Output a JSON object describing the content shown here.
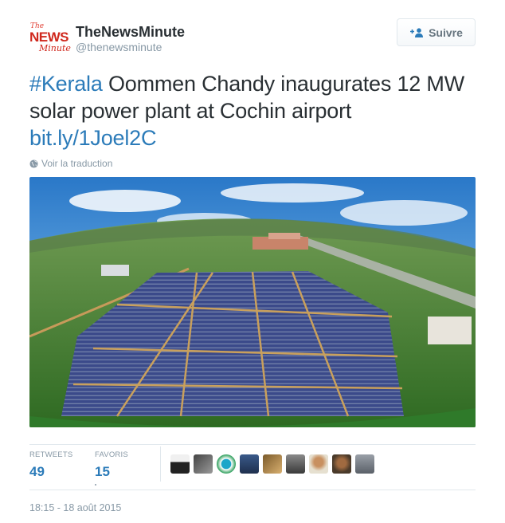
{
  "account": {
    "logo_the": "The",
    "logo_news": "NEWS",
    "logo_minute": "Minute",
    "full_name": "TheNewsMinute",
    "handle": "@thenewsminute"
  },
  "follow_button": {
    "label": "Suivre",
    "icon": "add-user-icon"
  },
  "tweet": {
    "hashtag": "#Kerala",
    "text": " Oommen Chandy inaugurates 12 MW solar power plant at Cochin airport ",
    "link": "bit.ly/1Joel2C"
  },
  "translate": {
    "label": "Voir la traduction",
    "icon": "globe-icon"
  },
  "photo": {
    "description_icon": "aerial-solar-plant-photo"
  },
  "stats": {
    "retweets_label": "RETWEETS",
    "retweets_value": "49",
    "favorites_label": "FAVORIS",
    "favorites_value": "15"
  },
  "avatars": [
    "avatar-1",
    "avatar-2",
    "avatar-3",
    "avatar-4",
    "avatar-5",
    "avatar-6",
    "avatar-7",
    "avatar-8",
    "avatar-9"
  ],
  "timestamp": "18:15 - 18 août 2015",
  "colors": {
    "link": "#2b7bb9",
    "muted": "#8899a6",
    "text": "#292f33",
    "brand_red": "#d0281d"
  }
}
